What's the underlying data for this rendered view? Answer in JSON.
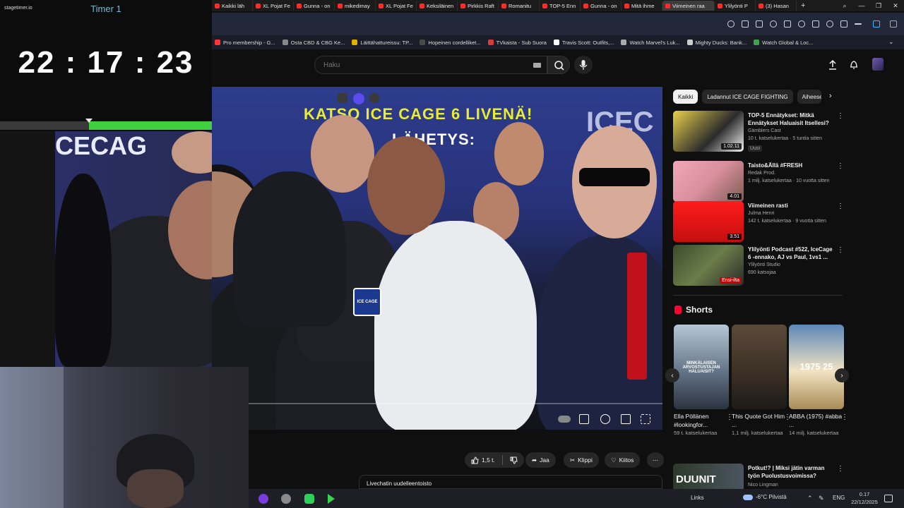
{
  "browser": {
    "tabs": [
      "Kaikki läh",
      "XL Pojat Fe",
      "Gunna - on",
      "mikedimay",
      "XL Pojat Fe",
      "Keksiläinen",
      "Pirkkis Raft",
      "Romanitu",
      "TOP-5 Enn",
      "Gunna - on",
      "Mitä ihme",
      "Viimeinen raa",
      "Ylilyönti P",
      "(3) Hasan"
    ],
    "active_tab_index": 11,
    "bookmarks": [
      {
        "label": "Pro membership - G...",
        "color": "#ff3333"
      },
      {
        "label": "Osta CBD & CBG Ke...",
        "color": "#888888"
      },
      {
        "label": "Läittähattureissu: TP...",
        "color": "#e2b100"
      },
      {
        "label": "Hopeinen cordelliket...",
        "color": "#4a4a4a"
      },
      {
        "label": "TVkaista - Sub Suora",
        "color": "#d63a3a"
      },
      {
        "label": "Travis Scott: Outfits,...",
        "color": "#ffffff"
      },
      {
        "label": "Watch Marvel's Luk...",
        "color": "#aaaaaa"
      },
      {
        "label": "Mighty Ducks: Bank...",
        "color": "#cccccc"
      },
      {
        "label": "Watch Global & Loc...",
        "color": "#3fa34d"
      }
    ]
  },
  "stagetimer": {
    "brand": "stagetimer.io",
    "title": "Timer 1",
    "time": "22 : 17 : 23",
    "progress": 0.42,
    "accent": "#3fcf3f"
  },
  "search": {
    "placeholder": "Haku"
  },
  "video": {
    "banner_line1": "KATSO ICE CAGE 6 LIVENÄ!",
    "banner_line2": "LÄHETYS:",
    "banner_side": "ICEC",
    "banner_left": "CECAG",
    "mic_label": "ICE CAGE"
  },
  "chips": [
    "Kaikki",
    "Ladannut ICE CAGE FIGHTING",
    "Aiheeseen liittyvät"
  ],
  "recommendations": [
    {
      "title": "TOP-5 Ennätykset: Mitkä Ennätykset Haluaisit Itsellesi?",
      "channel": "Gämblers Cast",
      "meta": "10 t. katselukertaa · 5 tuntia sitten",
      "badge": "Uusi",
      "duration": "1.02.11"
    },
    {
      "title": "Taisto&Ällä #FRESH",
      "channel": "Redak Prod.",
      "meta": "1 milj. katselukertaa · 10 vuotta sitten",
      "badge": "",
      "duration": "4.01"
    },
    {
      "title": "Viimeinen rasti",
      "channel": "Julma Henri",
      "meta": "142 t. katselukertaa · 9 vuotta sitten",
      "badge": "",
      "duration": "3.51"
    },
    {
      "title": "Ylilyönti Podcast #522, IceCage 6 -ennako, AJ vs Paul, 1vs1 ...",
      "channel": "Ylilyönti Studio",
      "meta": "690 katsojaa",
      "badge": "",
      "duration": "Ensi-ilta"
    }
  ],
  "shorts": {
    "heading": "Shorts",
    "items": [
      {
        "title": "Ella Pöllänen #lookingfor...",
        "views": "59 t. katselukertaa",
        "overlay": "MINKÄLAISEN ARVOSTUSTAJAN HALUAISIT?"
      },
      {
        "title": "This Quote Got Him ...",
        "views": "1,1 milj. katselukertaa",
        "overlay": ""
      },
      {
        "title": "ABBA (1975) #abba ...",
        "views": "14 milj. katselukertaa",
        "overlay": "1975 25"
      }
    ]
  },
  "rec5": {
    "title": "Potkut!? | Miksi jätin varman työn Puolustusvoimissa?",
    "channel": "Nico Lingman",
    "thumb_text": "DUUNIT"
  },
  "actions": {
    "like": "1,5 t.",
    "share": "Jaa",
    "clip": "Klippi",
    "thanks": "Kiitos",
    "chat_replay": "Livechatin uudelleentoisto"
  },
  "taskbar": {
    "links": "Links",
    "weather": "-6°C Pilvistä",
    "lang": "ENG",
    "time": "0.17",
    "date": "22/12/2025"
  }
}
